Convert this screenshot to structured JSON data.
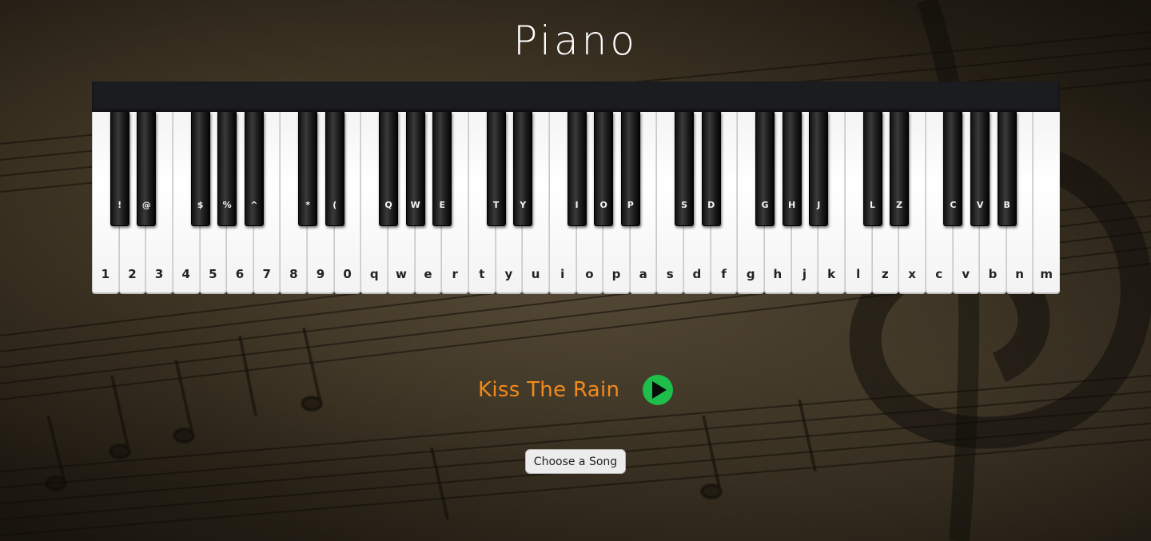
{
  "page": {
    "title": "Piano"
  },
  "piano": {
    "white_keys": [
      "1",
      "2",
      "3",
      "4",
      "5",
      "6",
      "7",
      "8",
      "9",
      "0",
      "q",
      "w",
      "e",
      "r",
      "t",
      "y",
      "u",
      "i",
      "o",
      "p",
      "a",
      "s",
      "d",
      "f",
      "g",
      "h",
      "j",
      "k",
      "l",
      "z",
      "x",
      "c",
      "v",
      "b",
      "n",
      "m"
    ],
    "black_keys": [
      "!",
      "@",
      "$",
      "%",
      "^",
      "*",
      "(",
      "Q",
      "W",
      "E",
      "T",
      "Y",
      "I",
      "O",
      "P",
      "S",
      "D",
      "G",
      "H",
      "J",
      "L",
      "Z",
      "C",
      "V",
      "B"
    ]
  },
  "player": {
    "song_title": "Kiss The Rain",
    "play_icon": "play-icon",
    "play_color": "#1dbf4a",
    "choose_label": "Choose a Song"
  },
  "colors": {
    "title": "#ffffff",
    "song_title": "#f28a1c",
    "piano_frame": "#1b1c20"
  }
}
